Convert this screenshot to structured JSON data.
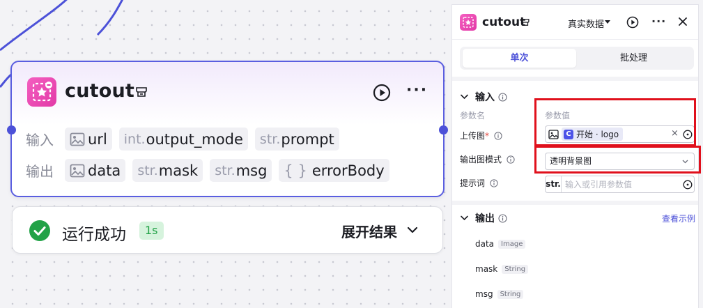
{
  "node": {
    "title": "cutout",
    "inputs_label": "输入",
    "outputs_label": "输出",
    "inputs": [
      {
        "prefix": "",
        "name": "url",
        "kind": "image"
      },
      {
        "prefix": "int.",
        "name": "output_mode",
        "kind": "typed"
      },
      {
        "prefix": "str.",
        "name": "prompt",
        "kind": "typed"
      }
    ],
    "outputs": [
      {
        "prefix": "",
        "name": "data",
        "kind": "image"
      },
      {
        "prefix": "str.",
        "name": "mask",
        "kind": "typed"
      },
      {
        "prefix": "str.",
        "name": "msg",
        "kind": "typed"
      },
      {
        "prefix": "{ }",
        "name": "errorBody",
        "kind": "object"
      }
    ]
  },
  "result": {
    "status": "运行成功",
    "duration": "1s",
    "expand": "展开结果"
  },
  "panel": {
    "title": "cutout",
    "data_mode": "真实数据",
    "tabs": {
      "single": "单次",
      "batch": "批处理"
    },
    "input_section": "输入",
    "col_name": "参数名",
    "col_value": "参数值",
    "upload_label": "上传图",
    "upload_required": "*",
    "upload_ref_icon": "C",
    "upload_ref": "开始 · logo",
    "mode_label": "输出图模式",
    "mode_value": "透明背景图",
    "prompt_label": "提示词",
    "prompt_type": "str.",
    "prompt_placeholder": "输入或引用参数值",
    "output_section": "输出",
    "example_link": "查看示例",
    "outputs": [
      {
        "name": "data",
        "type": "Image"
      },
      {
        "name": "mask",
        "type": "String"
      },
      {
        "name": "msg",
        "type": "String"
      }
    ]
  },
  "colors": {
    "accent": "#4c51d8",
    "node_border": "#5a5ee0",
    "success": "#22a247",
    "highlight": "#e0101c",
    "icon_pink": "#e23aa7"
  }
}
